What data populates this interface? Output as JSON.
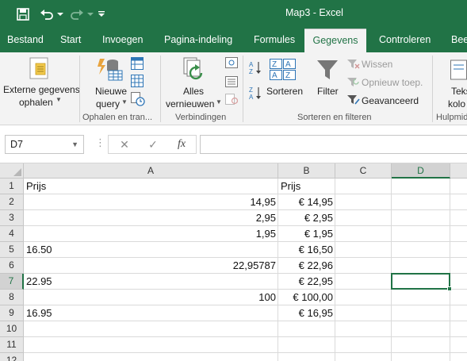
{
  "window": {
    "title": "Map3 - Excel"
  },
  "quick_access": [
    "save-icon",
    "undo-icon",
    "undo-dropdown-icon",
    "redo-icon",
    "redo-dropdown-icon",
    "customize-qat-icon"
  ],
  "tabs": [
    {
      "label": "Bestand"
    },
    {
      "label": "Start"
    },
    {
      "label": "Invoegen"
    },
    {
      "label": "Pagina-indeling"
    },
    {
      "label": "Formules"
    },
    {
      "label": "Gegevens",
      "active": true
    },
    {
      "label": "Controleren"
    },
    {
      "label": "Bee"
    }
  ],
  "ribbon": {
    "externe_line1": "Externe gegevens",
    "externe_line2": "ophalen",
    "nieuwe_line1": "Nieuwe",
    "nieuwe_line2": "query",
    "group_ophalen": "Ophalen en tran...",
    "alles_line1": "Alles",
    "alles_line2": "vernieuwen",
    "group_verbindingen": "Verbindingen",
    "sorteren": "Sorteren",
    "filter": "Filter",
    "wissen": "Wissen",
    "opnieuw": "Opnieuw toep.",
    "geavanceerd": "Geavanceerd",
    "group_sorteren": "Sorteren en filteren",
    "tekst_line1": "Teks",
    "tekst_line2": "kolo",
    "group_hulp": "Hulpmid"
  },
  "formula_bar": {
    "name_box": "D7",
    "fx_label": "fx",
    "formula": ""
  },
  "sheet": {
    "columns": [
      "A",
      "B",
      "C",
      "D"
    ],
    "selected_column": "D",
    "selected_row": 7,
    "rows": [
      {
        "n": "1",
        "a": "Prijs",
        "a_align": "left",
        "b": "Prijs",
        "b_align": "left"
      },
      {
        "n": "2",
        "a": "14,95",
        "a_align": "right",
        "b": "€ 14,95",
        "b_align": "right"
      },
      {
        "n": "3",
        "a": "2,95",
        "a_align": "right",
        "b": "€ 2,95",
        "b_align": "right"
      },
      {
        "n": "4",
        "a": "1,95",
        "a_align": "right",
        "b": "€ 1,95",
        "b_align": "right"
      },
      {
        "n": "5",
        "a": "16.50",
        "a_align": "left",
        "b": "€ 16,50",
        "b_align": "right"
      },
      {
        "n": "6",
        "a": "22,95787",
        "a_align": "right",
        "b": "€ 22,96",
        "b_align": "right"
      },
      {
        "n": "7",
        "a": "22.95",
        "a_align": "left",
        "b": "€ 22,95",
        "b_align": "right"
      },
      {
        "n": "8",
        "a": "100",
        "a_align": "right",
        "b": "€ 100,00",
        "b_align": "right"
      },
      {
        "n": "9",
        "a": "16.95",
        "a_align": "left",
        "b": "€ 16,95",
        "b_align": "right"
      },
      {
        "n": "10",
        "a": "",
        "a_align": "left",
        "b": "",
        "b_align": "left"
      },
      {
        "n": "11",
        "a": "",
        "a_align": "left",
        "b": "",
        "b_align": "left"
      },
      {
        "n": "12",
        "a": "",
        "a_align": "left",
        "b": "",
        "b_align": "left"
      }
    ]
  },
  "colors": {
    "excel_green": "#217346",
    "ribbon_bg": "#f3f3f3",
    "header_bg": "#e6e6e6",
    "gridline": "#dadada"
  }
}
